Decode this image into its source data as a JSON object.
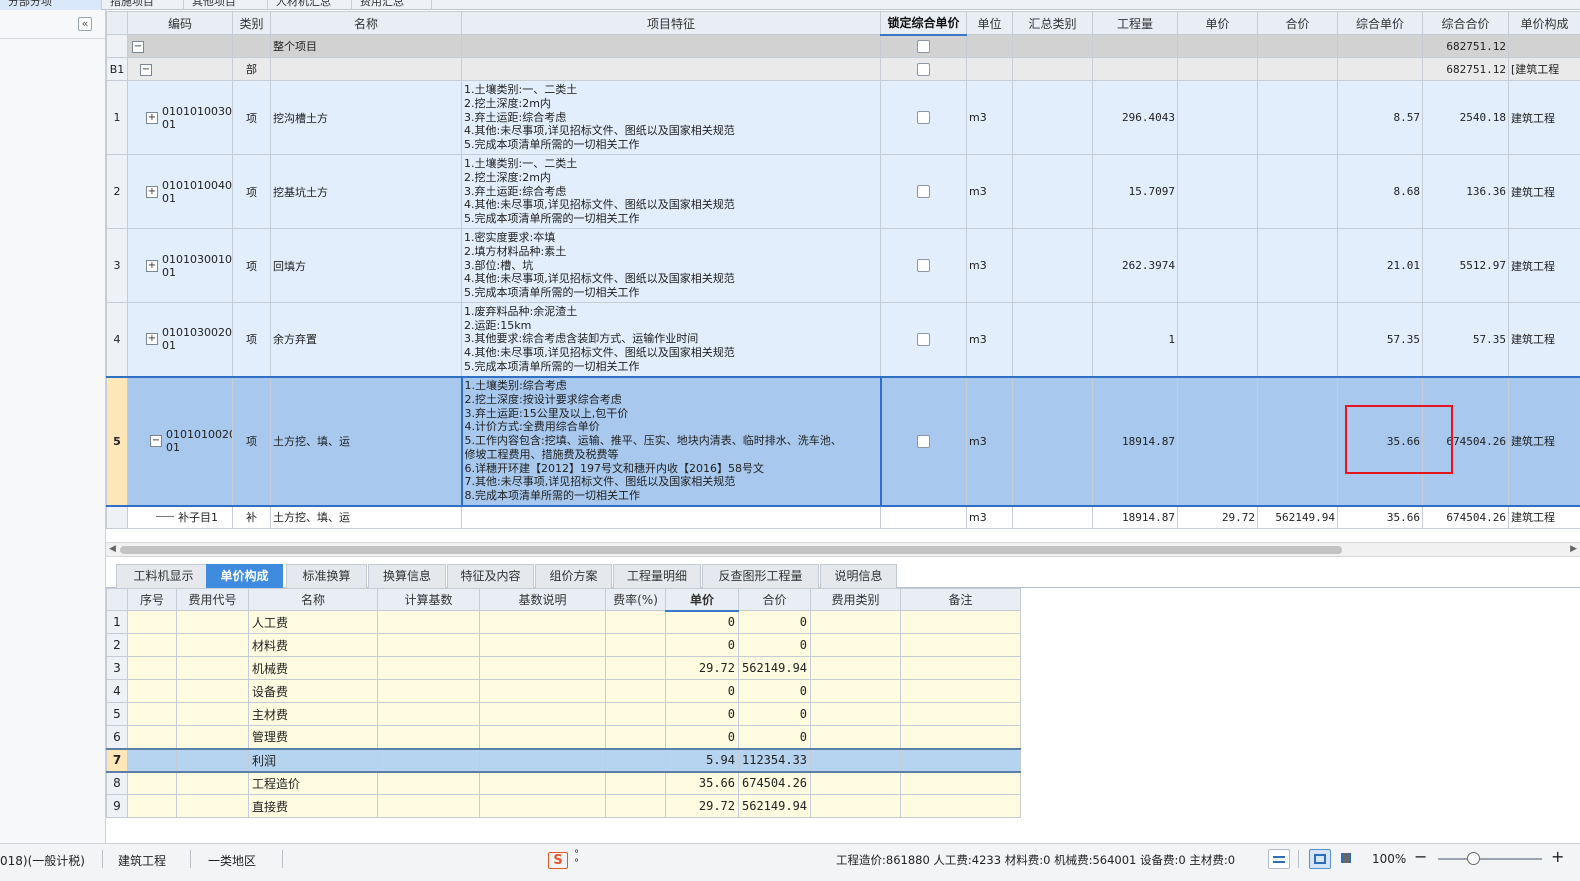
{
  "top_tabs": [
    {
      "label": "分部分项",
      "active": true
    },
    {
      "label": "措施项目",
      "active": false
    },
    {
      "label": "其他项目",
      "active": false
    },
    {
      "label": "人材机汇总",
      "active": false
    },
    {
      "label": "费用汇总",
      "active": false
    }
  ],
  "main_grid": {
    "headers": [
      "编码",
      "类别",
      "名称",
      "项目特征",
      "锁定综合单价",
      "单位",
      "汇总类别",
      "工程量",
      "单价",
      "合价",
      "综合单价",
      "综合合价",
      "单价构成"
    ],
    "summary_row": {
      "name": "整个项目",
      "total": "682751.12"
    },
    "part_row": {
      "rn": "B1",
      "type": "部",
      "total": "682751.12",
      "component": "[建筑工程"
    },
    "items": [
      {
        "rn": "1",
        "code_a": "0101010030",
        "code_b": "01",
        "type": "项",
        "name": "挖沟槽土方",
        "features": [
          "1.土壤类别:一、二类土",
          "2.挖土深度:2m内",
          "3.弃土运距:综合考虑",
          "4.其他:未尽事项,详见招标文件、图纸以及国家相关规范",
          "5.完成本项清单所需的一切相关工作"
        ],
        "unit": "m3",
        "qty": "296.4043",
        "comp_price": "8.57",
        "comp_total": "2540.18",
        "component": "建筑工程"
      },
      {
        "rn": "2",
        "code_a": "0101010040",
        "code_b": "01",
        "type": "项",
        "name": "挖基坑土方",
        "features": [
          "1.土壤类别:一、二类土",
          "2.挖土深度:2m内",
          "3.弃土运距:综合考虑",
          "4.其他:未尽事项,详见招标文件、图纸以及国家相关规范",
          "5.完成本项清单所需的一切相关工作"
        ],
        "unit": "m3",
        "qty": "15.7097",
        "comp_price": "8.68",
        "comp_total": "136.36",
        "component": "建筑工程"
      },
      {
        "rn": "3",
        "code_a": "0101030010",
        "code_b": "01",
        "type": "项",
        "name": "回填方",
        "features": [
          "1.密实度要求:夲填",
          "2.填方材料品种:素土",
          "3.部位:槽、坑",
          "4.其他:未尽事项,详见招标文件、图纸以及国家相关规范",
          "5.完成本项清单所需的一切相关工作"
        ],
        "unit": "m3",
        "qty": "262.3974",
        "comp_price": "21.01",
        "comp_total": "5512.97",
        "component": "建筑工程"
      },
      {
        "rn": "4",
        "code_a": "0101030020",
        "code_b": "01",
        "type": "项",
        "name": "余方弃置",
        "features": [
          "1.废弃料品种:余泥渣土",
          "2.运距:15km",
          "3.其他要求:综合考虑含装卸方式、运输作业时间",
          "4.其他:未尽事项,详见招标文件、图纸以及国家相关规范",
          "5.完成本项清单所需的一切相关工作"
        ],
        "unit": "m3",
        "qty": "1",
        "comp_price": "57.35",
        "comp_total": "57.35",
        "component": "建筑工程"
      },
      {
        "rn": "5",
        "code_a": "0101010020",
        "code_b": "01",
        "type": "项",
        "name": "土方挖、填、运",
        "features": [
          "1.土壤类别:综合考虑",
          "2.挖土深度:按设计要求综合考虑",
          "3.弃土运距:15公里及以上,包干价",
          "4.计价方式:全费用综合单价",
          "5.工作内容包含:挖填、运输、推平、压实、地块内清表、临时排水、洗车池、",
          "修坡工程费用、措施费及税费等",
          "6.详穗开环建【2012】197号文和穗开内收【2016】58号文",
          "7.其他:未尽事项,详见招标文件、图纸以及国家相关规范",
          "8.完成本项清单所需的一切相关工作"
        ],
        "unit": "m3",
        "qty": "18914.87",
        "comp_price": "35.66",
        "comp_total": "674504.26",
        "component": "建筑工程",
        "selected": true
      }
    ],
    "sub_row": {
      "code": "补子目1",
      "type": "补",
      "name": "土方挖、填、运",
      "unit": "m3",
      "qty": "18914.87",
      "price": "29.72",
      "total": "562149.94",
      "comp_price": "35.66",
      "comp_total": "674504.26",
      "component": "建筑工程"
    }
  },
  "bottom_tabs": [
    {
      "label": "工料机显示",
      "active": false
    },
    {
      "label": "单价构成",
      "active": true
    },
    {
      "label": "标准换算",
      "active": false
    },
    {
      "label": "换算信息",
      "active": false
    },
    {
      "label": "特征及内容",
      "active": false
    },
    {
      "label": "组价方案",
      "active": false
    },
    {
      "label": "工程量明细",
      "active": false
    },
    {
      "label": "反查图形工程量",
      "active": false
    },
    {
      "label": "说明信息",
      "active": false
    }
  ],
  "lower_grid": {
    "headers": [
      "序号",
      "费用代号",
      "名称",
      "计算基数",
      "基数说明",
      "费率(%)",
      "单价",
      "合价",
      "费用类别",
      "备注"
    ],
    "rows": [
      {
        "rn": "1",
        "name": "人工费",
        "unit_price": "0",
        "total": "0"
      },
      {
        "rn": "2",
        "name": "材料费",
        "unit_price": "0",
        "total": "0"
      },
      {
        "rn": "3",
        "name": "机械费",
        "unit_price": "29.72",
        "total": "562149.94"
      },
      {
        "rn": "4",
        "name": "设备费",
        "unit_price": "0",
        "total": "0"
      },
      {
        "rn": "5",
        "name": "主材费",
        "unit_price": "0",
        "total": "0"
      },
      {
        "rn": "6",
        "name": "管理费",
        "unit_price": "0",
        "total": "0"
      },
      {
        "rn": "7",
        "name": "利润",
        "unit_price": "5.94",
        "total": "112354.33",
        "selected": true
      },
      {
        "rn": "8",
        "name": "工程造价",
        "unit_price": "35.66",
        "total": "674504.26"
      },
      {
        "rn": "9",
        "name": "直接费",
        "unit_price": "29.72",
        "total": "562149.94"
      }
    ]
  },
  "status_bar": {
    "mode": "018)(一般计税)",
    "project_type": "建筑工程",
    "region": "一类地区",
    "totals": "工程造价:861880  人工费:4233  材料费:0  机械费:564001  设备费:0  主材费:0",
    "zoom": "100%",
    "logo": "S"
  }
}
